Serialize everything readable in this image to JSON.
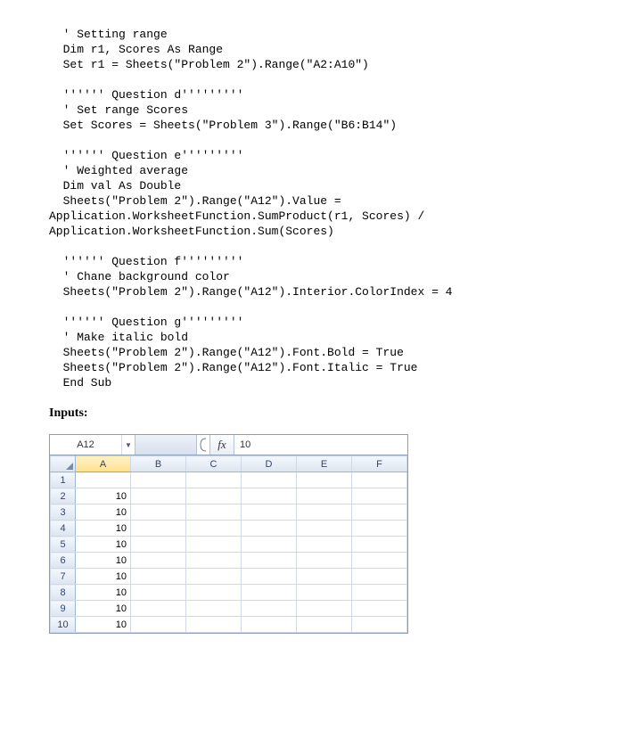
{
  "code": "  ' Setting range\n  Dim r1, Scores As Range\n  Set r1 = Sheets(\"Problem 2\").Range(\"A2:A10\")\n\n  '''''' Question d'''''''''\n  ' Set range Scores\n  Set Scores = Sheets(\"Problem 3\").Range(\"B6:B14\")\n\n  '''''' Question e'''''''''\n  ' Weighted average\n  Dim val As Double\n  Sheets(\"Problem 2\").Range(\"A12\").Value =\nApplication.WorksheetFunction.SumProduct(r1, Scores) /\nApplication.WorksheetFunction.Sum(Scores)\n\n  '''''' Question f'''''''''\n  ' Chane background color\n  Sheets(\"Problem 2\").Range(\"A12\").Interior.ColorIndex = 4\n\n  '''''' Question g'''''''''\n  ' Make italic bold\n  Sheets(\"Problem 2\").Range(\"A12\").Font.Bold = True\n  Sheets(\"Problem 2\").Range(\"A12\").Font.Italic = True\n  End Sub",
  "inputs_label": "Inputs:",
  "spreadsheet": {
    "namebox": "A12",
    "fx_label": "fx",
    "formula_value": "10",
    "columns": [
      "A",
      "B",
      "C",
      "D",
      "E",
      "F"
    ],
    "rows": [
      {
        "num": "1",
        "cells": [
          "",
          "",
          "",
          "",
          "",
          ""
        ]
      },
      {
        "num": "2",
        "cells": [
          "10",
          "",
          "",
          "",
          "",
          ""
        ]
      },
      {
        "num": "3",
        "cells": [
          "10",
          "",
          "",
          "",
          "",
          ""
        ]
      },
      {
        "num": "4",
        "cells": [
          "10",
          "",
          "",
          "",
          "",
          ""
        ]
      },
      {
        "num": "5",
        "cells": [
          "10",
          "",
          "",
          "",
          "",
          ""
        ]
      },
      {
        "num": "6",
        "cells": [
          "10",
          "",
          "",
          "",
          "",
          ""
        ]
      },
      {
        "num": "7",
        "cells": [
          "10",
          "",
          "",
          "",
          "",
          ""
        ]
      },
      {
        "num": "8",
        "cells": [
          "10",
          "",
          "",
          "",
          "",
          ""
        ]
      },
      {
        "num": "9",
        "cells": [
          "10",
          "",
          "",
          "",
          "",
          ""
        ]
      },
      {
        "num": "10",
        "cells": [
          "10",
          "",
          "",
          "",
          "",
          ""
        ]
      }
    ]
  }
}
